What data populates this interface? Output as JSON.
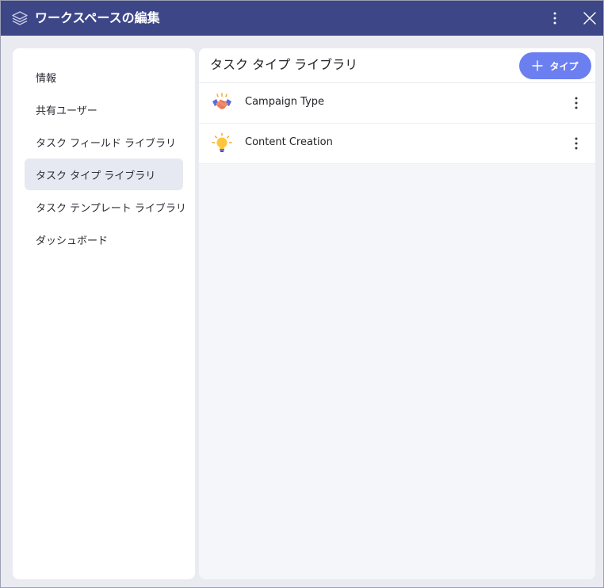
{
  "window": {
    "title": "ワークスペースの編集",
    "more_icon": "more-vertical-icon",
    "close_icon": "close-icon",
    "logo_icon": "layers-icon"
  },
  "sidebar": {
    "items": [
      {
        "label": "情報",
        "active": false
      },
      {
        "label": "共有ユーザー",
        "active": false
      },
      {
        "label": "タスク フィールド ライブラリ",
        "active": false
      },
      {
        "label": "タスク タイプ ライブラリ",
        "active": true
      },
      {
        "label": "タスク テンプレート ライブラリ",
        "active": false
      },
      {
        "label": "ダッシュボード",
        "active": false
      }
    ]
  },
  "main": {
    "title": "タスク タイプ ライブラリ",
    "add_button_label": "タイプ",
    "rows": [
      {
        "label": "Campaign Type",
        "icon": "handshake-icon"
      },
      {
        "label": "Content Creation",
        "icon": "lightbulb-icon"
      }
    ]
  },
  "colors": {
    "titlebar": "#3d4687",
    "accent": "#6c7ff0",
    "active_nav": "#e6e9f1",
    "background": "#e9ebf1"
  }
}
